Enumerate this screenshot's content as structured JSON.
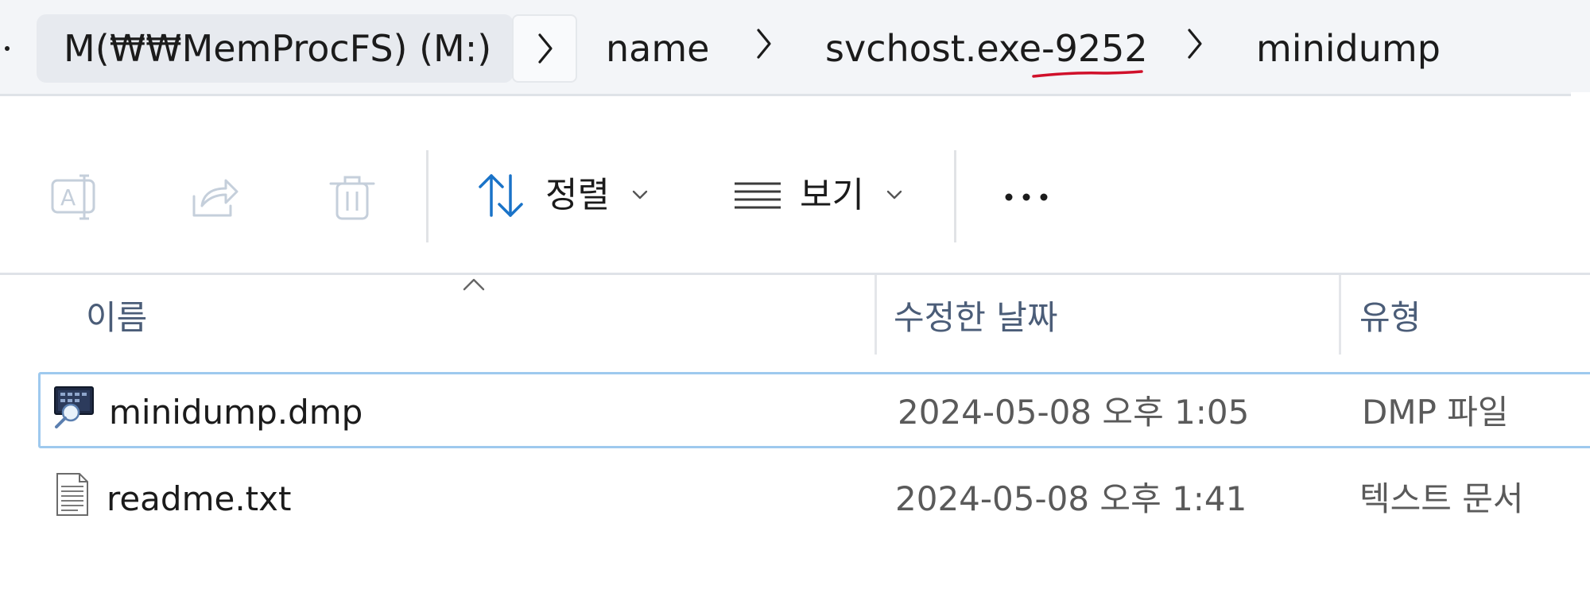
{
  "breadcrumb": {
    "root": "M(₩₩MemProcFS) (M:)",
    "items": [
      "name",
      "svchost.exe-9252",
      "minidump"
    ]
  },
  "toolbar": {
    "sort_label": "정렬",
    "view_label": "보기"
  },
  "columns": {
    "name": "이름",
    "modified": "수정한 날짜",
    "type": "유형"
  },
  "files": [
    {
      "name": "minidump.dmp",
      "modified": "2024-05-08 오후 1:05",
      "type": "DMP 파일",
      "icon": "dump-file-icon",
      "selected": true
    },
    {
      "name": "readme.txt",
      "modified": "2024-05-08 오후 1:41",
      "type": "텍스트 문서",
      "icon": "text-file-icon",
      "selected": false
    }
  ],
  "colors": {
    "accent": "#1a73c8",
    "selection_border": "#9ec9ee",
    "annotation_red": "#d0102a"
  }
}
